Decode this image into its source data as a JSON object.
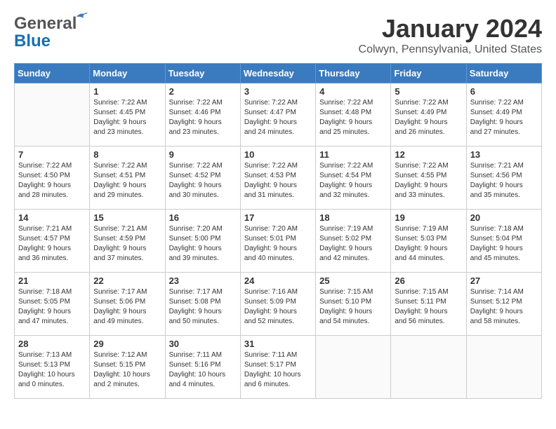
{
  "header": {
    "logo": {
      "line1": "General",
      "line2": "Blue"
    },
    "title": "January 2024",
    "subtitle": "Colwyn, Pennsylvania, United States"
  },
  "calendar": {
    "days_of_week": [
      "Sunday",
      "Monday",
      "Tuesday",
      "Wednesday",
      "Thursday",
      "Friday",
      "Saturday"
    ],
    "weeks": [
      [
        {
          "day": "",
          "content": ""
        },
        {
          "day": "1",
          "content": "Sunrise: 7:22 AM\nSunset: 4:45 PM\nDaylight: 9 hours\nand 23 minutes."
        },
        {
          "day": "2",
          "content": "Sunrise: 7:22 AM\nSunset: 4:46 PM\nDaylight: 9 hours\nand 23 minutes."
        },
        {
          "day": "3",
          "content": "Sunrise: 7:22 AM\nSunset: 4:47 PM\nDaylight: 9 hours\nand 24 minutes."
        },
        {
          "day": "4",
          "content": "Sunrise: 7:22 AM\nSunset: 4:48 PM\nDaylight: 9 hours\nand 25 minutes."
        },
        {
          "day": "5",
          "content": "Sunrise: 7:22 AM\nSunset: 4:49 PM\nDaylight: 9 hours\nand 26 minutes."
        },
        {
          "day": "6",
          "content": "Sunrise: 7:22 AM\nSunset: 4:49 PM\nDaylight: 9 hours\nand 27 minutes."
        }
      ],
      [
        {
          "day": "7",
          "content": "Sunrise: 7:22 AM\nSunset: 4:50 PM\nDaylight: 9 hours\nand 28 minutes."
        },
        {
          "day": "8",
          "content": "Sunrise: 7:22 AM\nSunset: 4:51 PM\nDaylight: 9 hours\nand 29 minutes."
        },
        {
          "day": "9",
          "content": "Sunrise: 7:22 AM\nSunset: 4:52 PM\nDaylight: 9 hours\nand 30 minutes."
        },
        {
          "day": "10",
          "content": "Sunrise: 7:22 AM\nSunset: 4:53 PM\nDaylight: 9 hours\nand 31 minutes."
        },
        {
          "day": "11",
          "content": "Sunrise: 7:22 AM\nSunset: 4:54 PM\nDaylight: 9 hours\nand 32 minutes."
        },
        {
          "day": "12",
          "content": "Sunrise: 7:22 AM\nSunset: 4:55 PM\nDaylight: 9 hours\nand 33 minutes."
        },
        {
          "day": "13",
          "content": "Sunrise: 7:21 AM\nSunset: 4:56 PM\nDaylight: 9 hours\nand 35 minutes."
        }
      ],
      [
        {
          "day": "14",
          "content": "Sunrise: 7:21 AM\nSunset: 4:57 PM\nDaylight: 9 hours\nand 36 minutes."
        },
        {
          "day": "15",
          "content": "Sunrise: 7:21 AM\nSunset: 4:59 PM\nDaylight: 9 hours\nand 37 minutes."
        },
        {
          "day": "16",
          "content": "Sunrise: 7:20 AM\nSunset: 5:00 PM\nDaylight: 9 hours\nand 39 minutes."
        },
        {
          "day": "17",
          "content": "Sunrise: 7:20 AM\nSunset: 5:01 PM\nDaylight: 9 hours\nand 40 minutes."
        },
        {
          "day": "18",
          "content": "Sunrise: 7:19 AM\nSunset: 5:02 PM\nDaylight: 9 hours\nand 42 minutes."
        },
        {
          "day": "19",
          "content": "Sunrise: 7:19 AM\nSunset: 5:03 PM\nDaylight: 9 hours\nand 44 minutes."
        },
        {
          "day": "20",
          "content": "Sunrise: 7:18 AM\nSunset: 5:04 PM\nDaylight: 9 hours\nand 45 minutes."
        }
      ],
      [
        {
          "day": "21",
          "content": "Sunrise: 7:18 AM\nSunset: 5:05 PM\nDaylight: 9 hours\nand 47 minutes."
        },
        {
          "day": "22",
          "content": "Sunrise: 7:17 AM\nSunset: 5:06 PM\nDaylight: 9 hours\nand 49 minutes."
        },
        {
          "day": "23",
          "content": "Sunrise: 7:17 AM\nSunset: 5:08 PM\nDaylight: 9 hours\nand 50 minutes."
        },
        {
          "day": "24",
          "content": "Sunrise: 7:16 AM\nSunset: 5:09 PM\nDaylight: 9 hours\nand 52 minutes."
        },
        {
          "day": "25",
          "content": "Sunrise: 7:15 AM\nSunset: 5:10 PM\nDaylight: 9 hours\nand 54 minutes."
        },
        {
          "day": "26",
          "content": "Sunrise: 7:15 AM\nSunset: 5:11 PM\nDaylight: 9 hours\nand 56 minutes."
        },
        {
          "day": "27",
          "content": "Sunrise: 7:14 AM\nSunset: 5:12 PM\nDaylight: 9 hours\nand 58 minutes."
        }
      ],
      [
        {
          "day": "28",
          "content": "Sunrise: 7:13 AM\nSunset: 5:13 PM\nDaylight: 10 hours\nand 0 minutes."
        },
        {
          "day": "29",
          "content": "Sunrise: 7:12 AM\nSunset: 5:15 PM\nDaylight: 10 hours\nand 2 minutes."
        },
        {
          "day": "30",
          "content": "Sunrise: 7:11 AM\nSunset: 5:16 PM\nDaylight: 10 hours\nand 4 minutes."
        },
        {
          "day": "31",
          "content": "Sunrise: 7:11 AM\nSunset: 5:17 PM\nDaylight: 10 hours\nand 6 minutes."
        },
        {
          "day": "",
          "content": ""
        },
        {
          "day": "",
          "content": ""
        },
        {
          "day": "",
          "content": ""
        }
      ]
    ]
  }
}
